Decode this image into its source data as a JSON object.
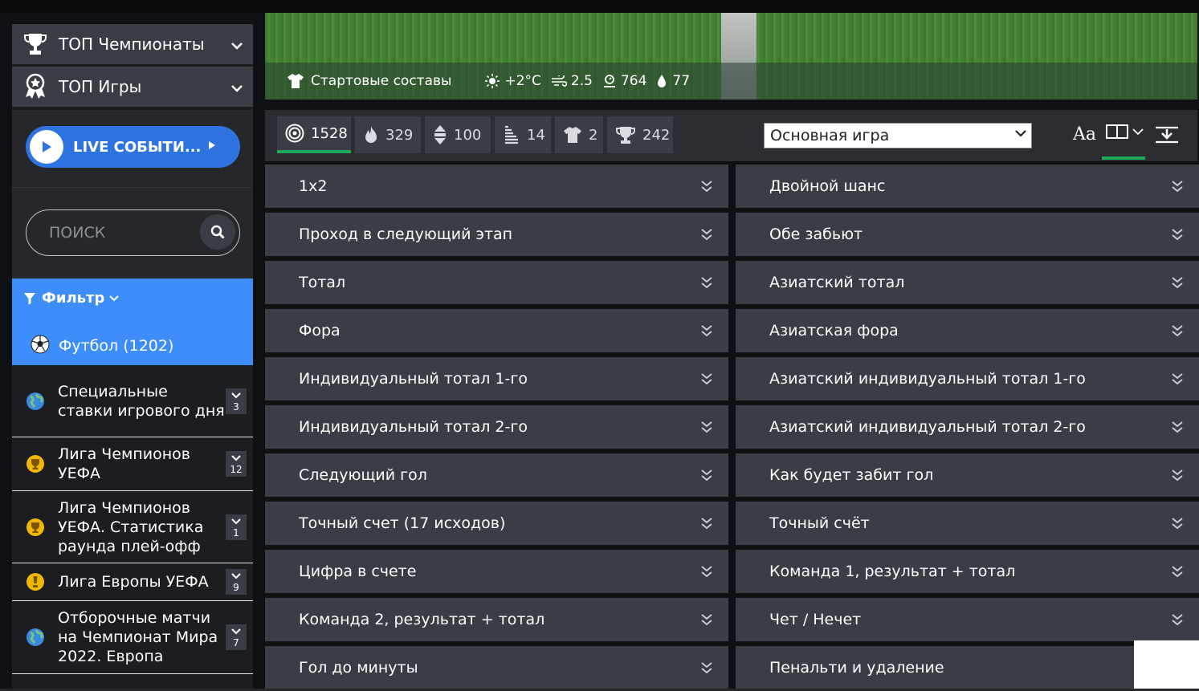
{
  "sidebar": {
    "top_championships": "ТОП Чемпионаты",
    "top_games": "ТОП Игры",
    "live_label": "LIVE СОБЫТИ...",
    "search_placeholder": "ПОИСК",
    "filter_label": "Фильтр",
    "sport_label": "Футбол (1202)",
    "leagues": [
      {
        "name": "Специальные ставки игрового дня",
        "count": "3",
        "icon": "globe-icon"
      },
      {
        "name": "Лига Чемпионов УЕФА",
        "count": "12",
        "icon": "trophy-icon"
      },
      {
        "name": "Лига Чемпионов УЕФА. Статистика раунда плей-офф",
        "count": "1",
        "icon": "trophy-icon"
      },
      {
        "name": "Лига Европы УЕФА",
        "count": "9",
        "icon": "trophy-icon"
      },
      {
        "name": "Отборочные матчи на Чемпионат Мира 2022. Европа",
        "count": "7",
        "icon": "globe-icon"
      }
    ]
  },
  "banner": {
    "lineups": "Стартовые составы",
    "temperature": "+2°C",
    "wind": "2.5",
    "pressure": "764",
    "humidity": "77"
  },
  "toolbar": {
    "stats": [
      {
        "value": "1528",
        "icon": "target-icon"
      },
      {
        "value": "329",
        "icon": "fire-icon"
      },
      {
        "value": "100",
        "icon": "updown-icon"
      },
      {
        "value": "14",
        "icon": "bars-icon"
      },
      {
        "value": "2",
        "icon": "shirt-icon"
      },
      {
        "value": "242",
        "icon": "cup-icon"
      }
    ],
    "game_select": "Основная игра",
    "font_label": "Aa"
  },
  "markets": [
    "1x2",
    "Двойной шанс",
    "Проход в следующий этап",
    "Обе забьют",
    "Тотал",
    "Азиатский тотал",
    "Фора",
    "Азиатская фора",
    "Индивидуальный тотал 1-го",
    "Азиатский индивидуальный тотал 1-го",
    "Индивидуальный тотал 2-го",
    "Азиатский индивидуальный тотал 2-го",
    "Следующий гол",
    "Как будет забит гол",
    "Точный счет (17 исходов)",
    "Точный счёт",
    "Цифра в счете",
    "Команда 1, результат + тотал",
    "Команда 2, результат + тотал",
    "Чет / Нечет",
    "Гол до минуты",
    "Пенальти и удаление"
  ],
  "colors": {
    "accent_blue": "#3d8dfa",
    "live_blue": "#2f73e0",
    "active_green": "#1ea85a",
    "panel": "#3a3d45"
  }
}
